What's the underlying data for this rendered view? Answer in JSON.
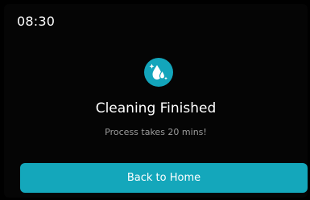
{
  "status_bar": {
    "time": "08:30"
  },
  "status_icon": {
    "name": "cleaning-droplets-icon",
    "color": "#13a5bb"
  },
  "message": {
    "title": "Cleaning Finished",
    "subtitle": "Process takes 20 mins!"
  },
  "actions": {
    "back_label": "Back to Home"
  },
  "colors": {
    "accent": "#14a7bb",
    "background": "#000000",
    "subtitle": "#9c9c9c"
  }
}
